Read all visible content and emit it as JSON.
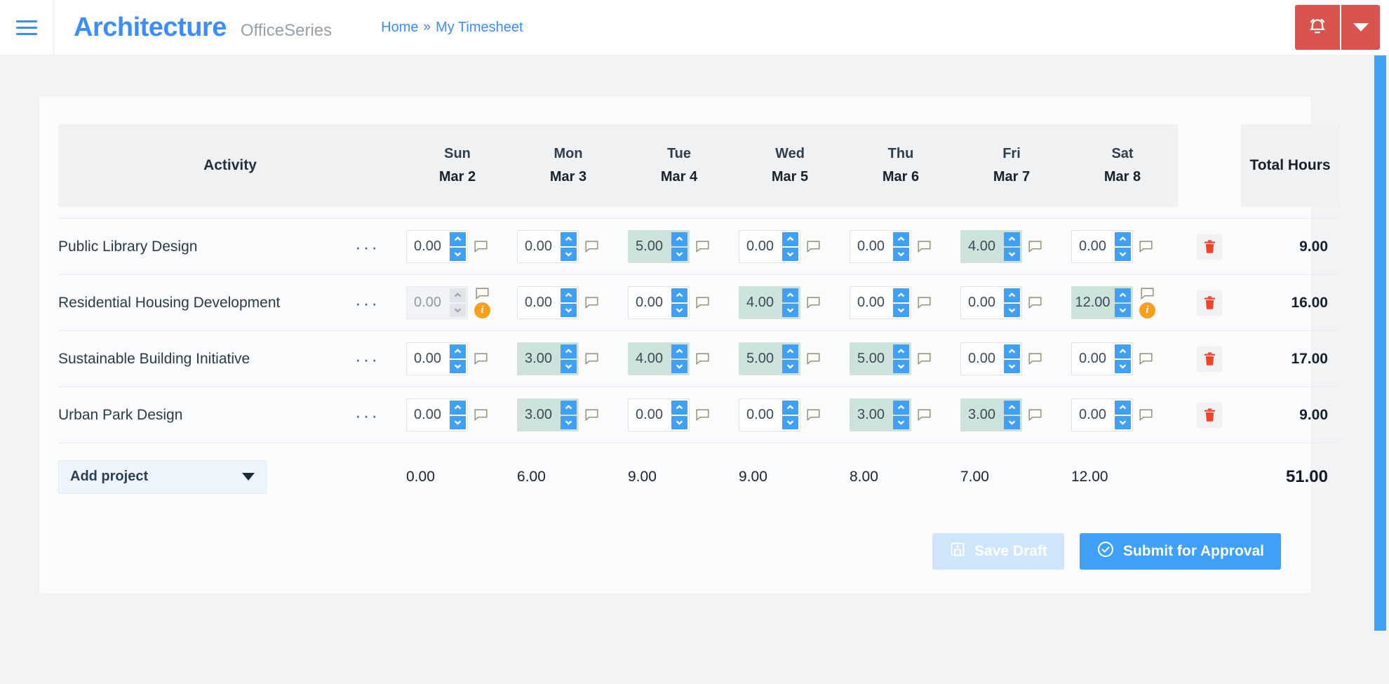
{
  "header": {
    "menu_icon": "hamburger-icon",
    "brand": "Architecture",
    "brand_sub": "OfficeSeries",
    "breadcrumb": {
      "home": "Home",
      "separator": "»",
      "current": "My Timesheet"
    },
    "bell_icon": "alarm-bell-icon",
    "caret_icon": "chevron-down-icon",
    "accent_red": "#d9534f",
    "accent_blue": "#3c8dfd"
  },
  "table": {
    "columns": [
      {
        "label": "Activity"
      },
      {
        "dow": "Sun",
        "date": "Mar 2"
      },
      {
        "dow": "Mon",
        "date": "Mar 3"
      },
      {
        "dow": "Tue",
        "date": "Mar 4"
      },
      {
        "dow": "Wed",
        "date": "Mar 5"
      },
      {
        "dow": "Thu",
        "date": "Mar 6"
      },
      {
        "dow": "Fri",
        "date": "Mar 7"
      },
      {
        "dow": "Sat",
        "date": "Mar 8"
      },
      {
        "label": "Total Hours"
      }
    ],
    "rows": [
      {
        "activity": "Public Library Design",
        "menu": "···",
        "cells": [
          {
            "value": "0.00",
            "state": "normal"
          },
          {
            "value": "0.00",
            "state": "normal"
          },
          {
            "value": "5.00",
            "state": "highlight"
          },
          {
            "value": "0.00",
            "state": "normal"
          },
          {
            "value": "0.00",
            "state": "normal"
          },
          {
            "value": "4.00",
            "state": "highlight"
          },
          {
            "value": "0.00",
            "state": "normal"
          }
        ],
        "total": "9.00",
        "delete_icon": "trash-icon"
      },
      {
        "activity": "Residential Housing Development",
        "menu": "···",
        "cells": [
          {
            "value": "0.00",
            "state": "disabled",
            "warning": "i"
          },
          {
            "value": "0.00",
            "state": "normal"
          },
          {
            "value": "0.00",
            "state": "normal"
          },
          {
            "value": "4.00",
            "state": "highlight"
          },
          {
            "value": "0.00",
            "state": "normal"
          },
          {
            "value": "0.00",
            "state": "normal"
          },
          {
            "value": "12.00",
            "state": "highlight",
            "warning": "i"
          }
        ],
        "total": "16.00",
        "delete_icon": "trash-icon"
      },
      {
        "activity": "Sustainable Building Initiative",
        "menu": "···",
        "cells": [
          {
            "value": "0.00",
            "state": "normal"
          },
          {
            "value": "3.00",
            "state": "highlight"
          },
          {
            "value": "4.00",
            "state": "highlight"
          },
          {
            "value": "5.00",
            "state": "highlight"
          },
          {
            "value": "5.00",
            "state": "highlight"
          },
          {
            "value": "0.00",
            "state": "normal"
          },
          {
            "value": "0.00",
            "state": "normal"
          }
        ],
        "total": "17.00",
        "delete_icon": "trash-icon"
      },
      {
        "activity": "Urban Park Design",
        "menu": "···",
        "cells": [
          {
            "value": "0.00",
            "state": "normal"
          },
          {
            "value": "3.00",
            "state": "highlight"
          },
          {
            "value": "0.00",
            "state": "normal"
          },
          {
            "value": "0.00",
            "state": "normal"
          },
          {
            "value": "3.00",
            "state": "highlight"
          },
          {
            "value": "3.00",
            "state": "highlight"
          },
          {
            "value": "0.00",
            "state": "normal"
          }
        ],
        "total": "9.00",
        "delete_icon": "trash-icon"
      }
    ],
    "footer": {
      "add_project": "Add project",
      "add_project_caret": "chevron-down-icon",
      "day_totals": [
        "0.00",
        "6.00",
        "9.00",
        "9.00",
        "8.00",
        "7.00",
        "12.00"
      ],
      "grand_total": "51.00"
    }
  },
  "actions": {
    "save_draft": "Save Draft",
    "save_draft_icon": "save-disk-icon",
    "save_draft_disabled": true,
    "submit": "Submit for Approval",
    "submit_icon": "check-circle-icon"
  },
  "colors": {
    "highlight_cell": "#cee2dc",
    "spinner_blue": "#3fa0f5",
    "warning_orange": "#f7a020",
    "delete_red": "#f4412e"
  }
}
